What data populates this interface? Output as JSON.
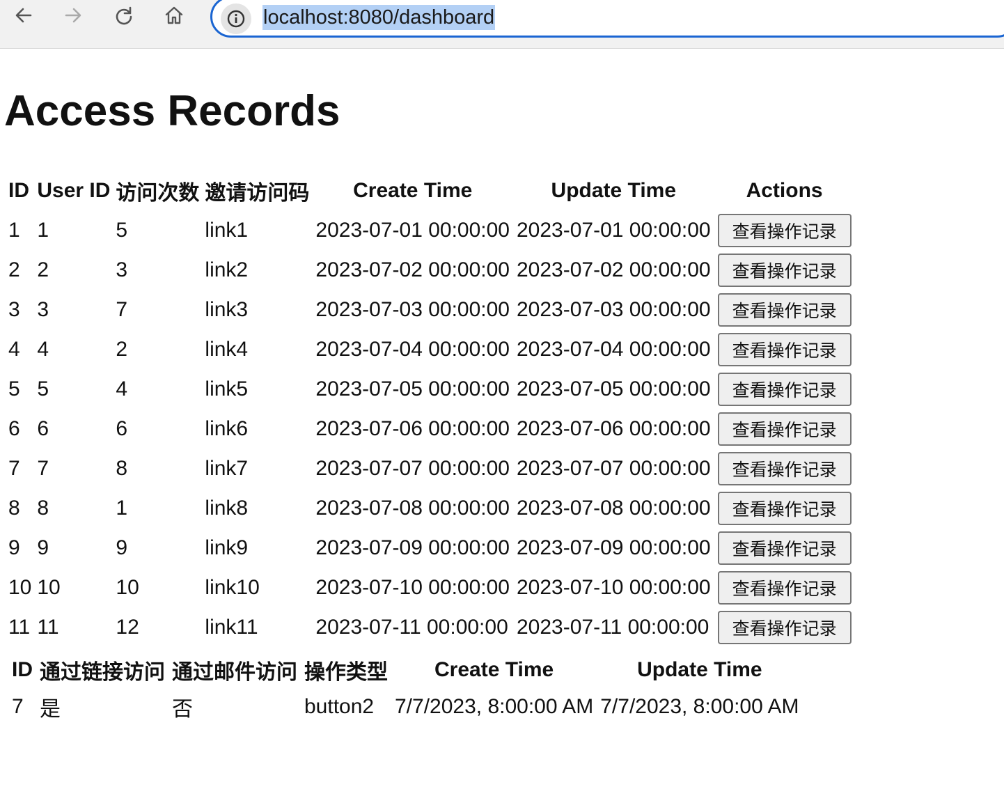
{
  "browser": {
    "url": "localhost:8080/dashboard",
    "icons": [
      "back-arrow-icon",
      "forward-arrow-icon",
      "reload-icon",
      "home-icon",
      "site-info-icon"
    ]
  },
  "page": {
    "title": "Access Records"
  },
  "records_table": {
    "headers": [
      "ID",
      "User ID",
      "访问次数",
      "邀请访问码",
      "Create Time",
      "Update Time",
      "Actions"
    ],
    "action_label": "查看操作记录",
    "rows": [
      {
        "id": "1",
        "user_id": "1",
        "visits": "5",
        "code": "link1",
        "create": "2023-07-01 00:00:00",
        "update": "2023-07-01 00:00:00"
      },
      {
        "id": "2",
        "user_id": "2",
        "visits": "3",
        "code": "link2",
        "create": "2023-07-02 00:00:00",
        "update": "2023-07-02 00:00:00"
      },
      {
        "id": "3",
        "user_id": "3",
        "visits": "7",
        "code": "link3",
        "create": "2023-07-03 00:00:00",
        "update": "2023-07-03 00:00:00"
      },
      {
        "id": "4",
        "user_id": "4",
        "visits": "2",
        "code": "link4",
        "create": "2023-07-04 00:00:00",
        "update": "2023-07-04 00:00:00"
      },
      {
        "id": "5",
        "user_id": "5",
        "visits": "4",
        "code": "link5",
        "create": "2023-07-05 00:00:00",
        "update": "2023-07-05 00:00:00"
      },
      {
        "id": "6",
        "user_id": "6",
        "visits": "6",
        "code": "link6",
        "create": "2023-07-06 00:00:00",
        "update": "2023-07-06 00:00:00"
      },
      {
        "id": "7",
        "user_id": "7",
        "visits": "8",
        "code": "link7",
        "create": "2023-07-07 00:00:00",
        "update": "2023-07-07 00:00:00"
      },
      {
        "id": "8",
        "user_id": "8",
        "visits": "1",
        "code": "link8",
        "create": "2023-07-08 00:00:00",
        "update": "2023-07-08 00:00:00"
      },
      {
        "id": "9",
        "user_id": "9",
        "visits": "9",
        "code": "link9",
        "create": "2023-07-09 00:00:00",
        "update": "2023-07-09 00:00:00"
      },
      {
        "id": "10",
        "user_id": "10",
        "visits": "10",
        "code": "link10",
        "create": "2023-07-10 00:00:00",
        "update": "2023-07-10 00:00:00"
      },
      {
        "id": "11",
        "user_id": "11",
        "visits": "12",
        "code": "link11",
        "create": "2023-07-11 00:00:00",
        "update": "2023-07-11 00:00:00"
      }
    ]
  },
  "operations_table": {
    "headers": [
      "ID",
      "通过链接访问",
      "通过邮件访问",
      "操作类型",
      "Create Time",
      "Update Time"
    ],
    "rows": [
      {
        "id": "7",
        "via_link": "是",
        "via_email": "否",
        "type": "button2",
        "create": "7/7/2023, 8:00:00 AM",
        "update": "7/7/2023, 8:00:00 AM"
      }
    ]
  }
}
